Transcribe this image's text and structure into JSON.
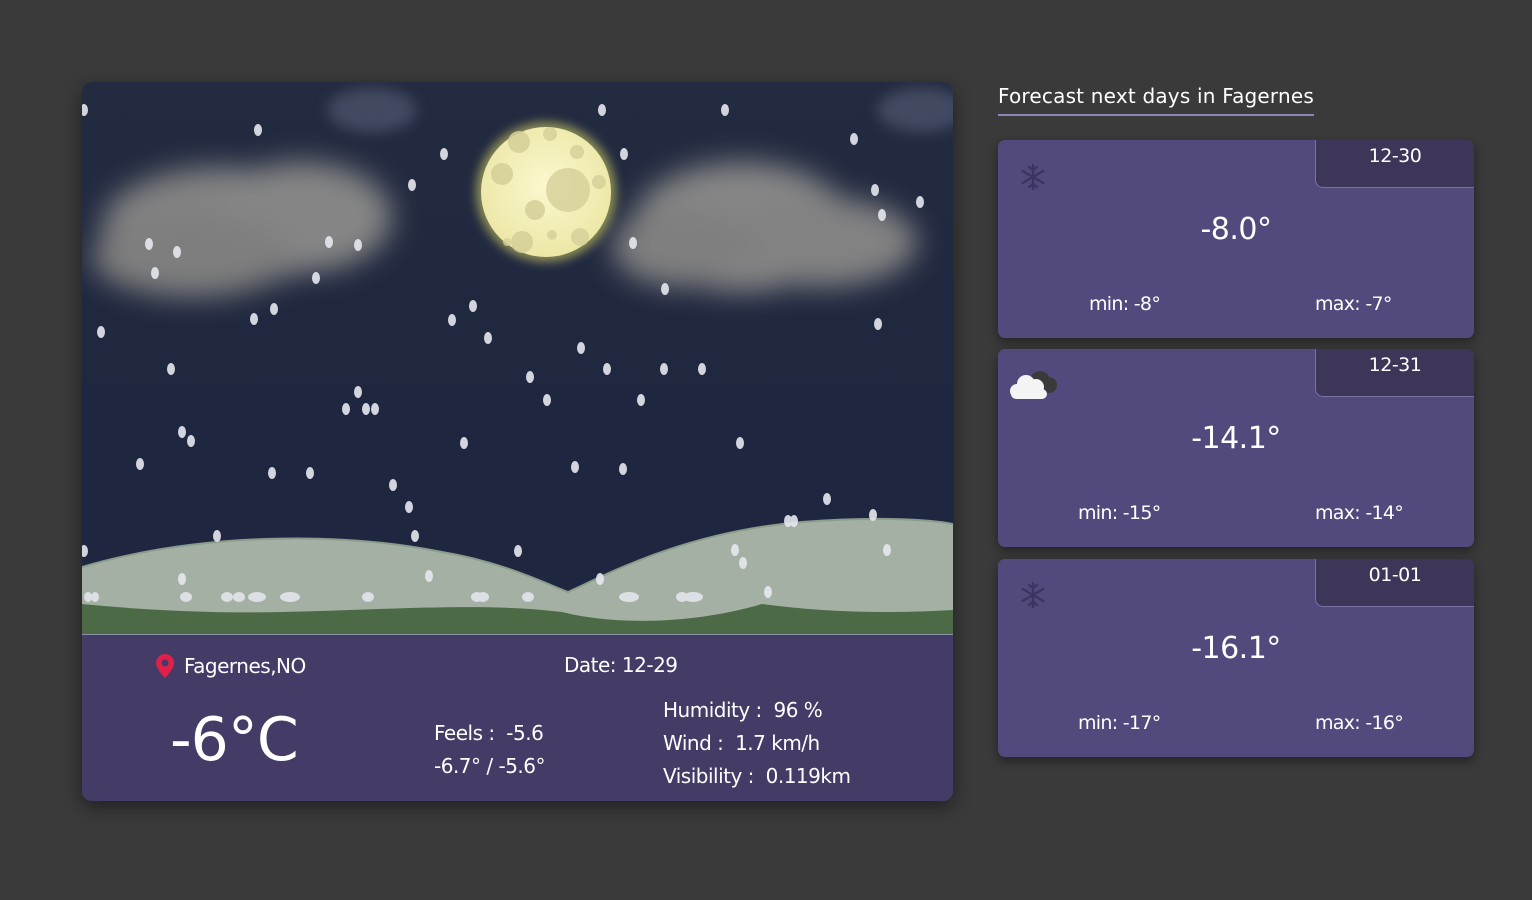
{
  "current": {
    "location": "Fagernes,NO",
    "date_label": "Date: 12-29",
    "temperature": "-6°C",
    "feels_label": "Feels :  -5.6",
    "range": "-6.7° / -5.6°",
    "humidity": "Humidity :  96 %",
    "wind": "Wind :  1.7 km/h",
    "visibility": "Visibility :  0.119km",
    "scene": "night-snow-with-moon-and-clouds",
    "icons": {
      "location": "map-pin-icon"
    }
  },
  "forecast": {
    "title": "Forecast next days in Fagernes",
    "days": [
      {
        "date": "12-30",
        "temp": "-8.0°",
        "min": "min: -8°",
        "max": "max: -7°",
        "icon": "snowflake-icon"
      },
      {
        "date": "12-31",
        "temp": "-14.1°",
        "min": "min: -15°",
        "max": "max: -14°",
        "icon": "cloud-icon"
      },
      {
        "date": "01-01",
        "temp": "-16.1°",
        "min": "min: -17°",
        "max": "max: -16°",
        "icon": "snowflake-icon"
      }
    ]
  },
  "colors": {
    "page_bg": "#3a3a3a",
    "sky": "#1f2740",
    "info_panel": "#443c66",
    "forecast_card": "#524a7c",
    "forecast_date_tab": "#3d3659",
    "pin": "#e0204a",
    "moon": "#f3f0b8"
  }
}
